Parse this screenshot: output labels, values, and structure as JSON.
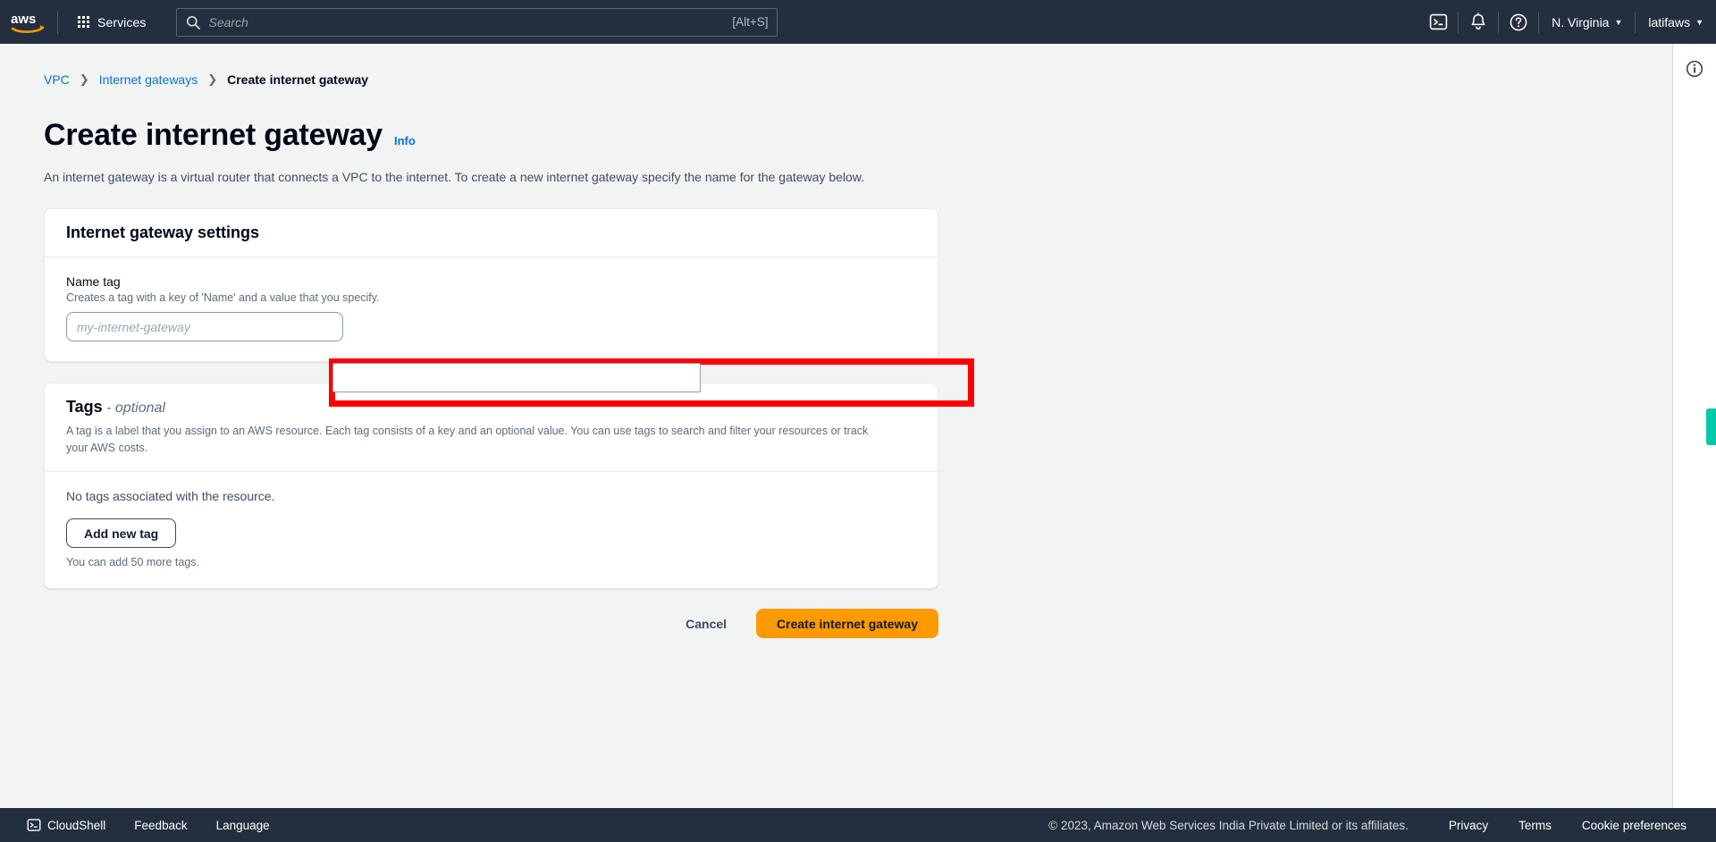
{
  "topnav": {
    "logo_name": "aws-logo",
    "services_label": "Services",
    "search": {
      "placeholder": "Search",
      "value": "",
      "shortcut": "[Alt+S]"
    },
    "icons": {
      "cloudshell": "cloudshell-icon",
      "notifications": "bell-icon",
      "help": "question-mark-icon"
    },
    "region": "N. Virginia",
    "account": "latifaws",
    "caret": "▼"
  },
  "breadcrumb": {
    "items": [
      {
        "label": "VPC",
        "current": false
      },
      {
        "label": "Internet gateways",
        "current": false
      },
      {
        "label": "Create internet gateway",
        "current": true
      }
    ],
    "separator": "❯"
  },
  "page": {
    "title": "Create internet gateway",
    "info_label": "Info",
    "description": "An internet gateway is a virtual router that connects a VPC to the internet. To create a new internet gateway specify the name for the gateway below."
  },
  "settings_card": {
    "title": "Internet gateway settings",
    "name_tag": {
      "label": "Name tag",
      "hint": "Creates a tag with a key of 'Name' and a value that you specify.",
      "placeholder": "my-internet-gateway",
      "value": ""
    }
  },
  "tags_card": {
    "title": "Tags",
    "title_optional": " - optional",
    "description": "A tag is a label that you assign to an AWS resource. Each tag consists of a key and an optional value. You can use tags to search and filter your resources or track your AWS costs.",
    "empty_text": "No tags associated with the resource.",
    "add_button": "Add new tag",
    "limit_note": "You can add 50 more tags."
  },
  "actions": {
    "cancel": "Cancel",
    "submit": "Create internet gateway"
  },
  "right_rail": {
    "info_icon": "info-circle-icon",
    "feedback_tab": "feedback-tab"
  },
  "footer": {
    "cloudshell": "CloudShell",
    "feedback": "Feedback",
    "language": "Language",
    "copyright": "© 2023, Amazon Web Services India Private Limited or its affiliates.",
    "privacy": "Privacy",
    "terms": "Terms",
    "cookies": "Cookie preferences"
  },
  "colors": {
    "nav_bg": "#232f3e",
    "page_bg": "#f2f3f3",
    "link": "#0972d3",
    "primary_button": "#ff9900",
    "annotation": "#fe0000",
    "feedback_tab": "#00c9a7"
  }
}
